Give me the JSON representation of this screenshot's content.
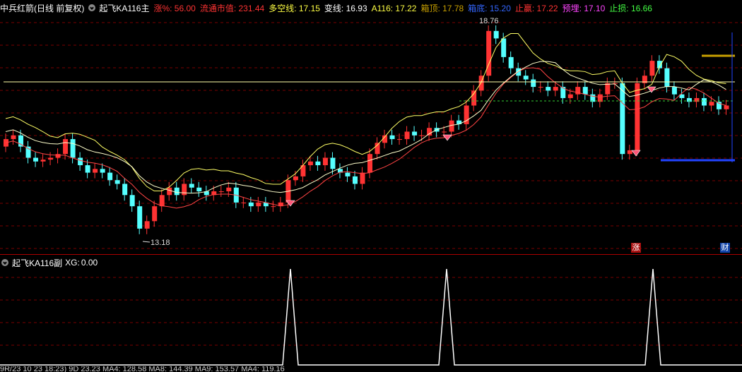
{
  "main_header": {
    "stock_title": "中兵红箭(日线 前复权)",
    "indicator_name": "起飞KA116主",
    "items": [
      {
        "label": "涨%:",
        "value": "56.00",
        "color": "#ff3333"
      },
      {
        "label": "流通市值:",
        "value": "231.44",
        "color": "#ff3333"
      },
      {
        "label": "多空线:",
        "value": "17.15",
        "color": "#ffff44"
      },
      {
        "label": "变线:",
        "value": "16.93",
        "color": "#ffffff"
      },
      {
        "label": "A116:",
        "value": "17.22",
        "color": "#ffff44"
      },
      {
        "label": "箱顶:",
        "value": "17.78",
        "color": "#c8a000"
      },
      {
        "label": "箱底:",
        "value": "15.20",
        "color": "#3366ff"
      },
      {
        "label": "止赢:",
        "value": "17.22",
        "color": "#ff3333"
      },
      {
        "label": "预埋:",
        "value": "17.10",
        "color": "#ff44ff"
      },
      {
        "label": "止损:",
        "value": "16.66",
        "color": "#44ff44"
      }
    ]
  },
  "price_annotations": {
    "high": "18.76",
    "low": "13.18"
  },
  "badges": {
    "zhang": "涨",
    "cai": "财"
  },
  "sub_header": {
    "indicator_name": "起飞KA116副",
    "xg_label": "XG:",
    "xg_value": "0.00"
  },
  "bottom_bar": {
    "text": "9R/23 10 23 18:23)  9D 23.23  MA4: 128.58  MA8: 144.39  MA9: 153.57  MA4: 119.16"
  },
  "colors": {
    "up": "#ff3333",
    "down": "#55ffff",
    "signal": "#ffdd00",
    "buy": "#22cc22"
  }
}
